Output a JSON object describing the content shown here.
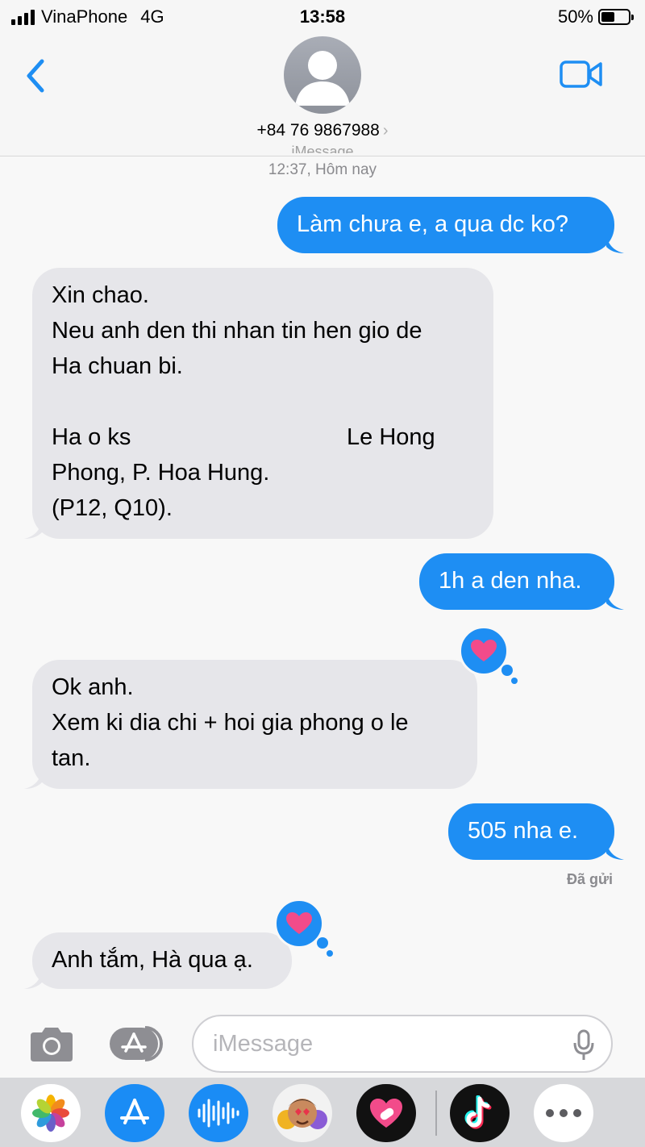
{
  "status_bar": {
    "carrier": "VinaPhone",
    "network": "4G",
    "time": "13:58",
    "battery_text": "50%",
    "battery_level": 0.5
  },
  "header": {
    "contact": "+84 76 9867988",
    "chevron": "›"
  },
  "thread": {
    "service_label": "iMessage",
    "timestamp": "12:37, Hôm nay",
    "messages": [
      {
        "direction": "out",
        "lines": [
          "Làm chưa e, a qua dc ko?"
        ]
      },
      {
        "direction": "in",
        "lines": [
          "Xin chao.",
          "Neu anh den thi nhan tin hen gio de",
          "Ha chuan bi.",
          "",
          "Ha o ks",
          "Le Hong",
          "Phong, P. Hoa Hung.",
          "(P12, Q10)."
        ]
      },
      {
        "direction": "out",
        "lines": [
          "1h a den nha."
        ]
      },
      {
        "direction": "in",
        "lines": [
          "Ok anh.",
          "Xem ki dia chi + hoi gia phong o le",
          "tan."
        ],
        "tapback": "heart"
      },
      {
        "direction": "out",
        "lines": [
          "505 nha e."
        ],
        "status": "Đã gửi"
      },
      {
        "direction": "in",
        "lines": [
          "Anh tắm, Hà qua ạ."
        ],
        "tapback": "heart"
      }
    ]
  },
  "input_bar": {
    "placeholder": "iMessage"
  },
  "app_drawer": {
    "apps": [
      "photos-icon",
      "app-store-icon",
      "audio-message-icon",
      "memoji-icon",
      "digital-touch-icon",
      "tiktok-icon",
      "more-icon"
    ]
  },
  "colors": {
    "accent": "#1e8ef3",
    "incoming_bubble": "#e6e6ea",
    "tapback_heart": "#f24b8a"
  }
}
